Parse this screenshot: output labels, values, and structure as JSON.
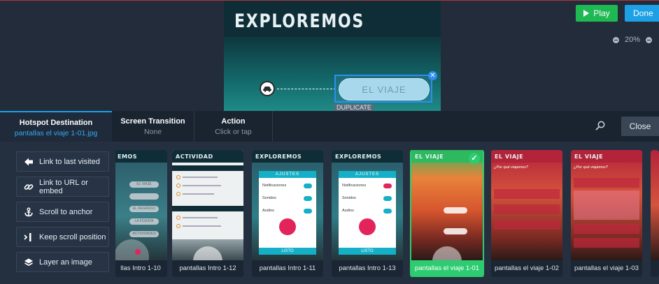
{
  "canvas": {
    "phone_title": "EXPLOREMOS",
    "hotspot_label": "EL VIAJE",
    "duplicate_label": "DUPLICATE",
    "play_label": "Play",
    "done_label": "Done",
    "zoom_level": "20%"
  },
  "tabs": [
    {
      "title": "Hotspot Destination",
      "value": "pantallas el viaje 1-01.jpg"
    },
    {
      "title": "Screen Transition",
      "value": "None"
    },
    {
      "title": "Action",
      "value": "Click or tap"
    }
  ],
  "close_label": "Close",
  "sidebar": {
    "items": [
      {
        "label": "Link to last visited",
        "icon": "arrow-left-icon"
      },
      {
        "label": "Link to URL or embed",
        "icon": "link-icon"
      },
      {
        "label": "Scroll to anchor",
        "icon": "anchor-icon"
      },
      {
        "label": "Keep scroll position",
        "icon": "keep-scroll-icon"
      },
      {
        "label": "Layer an image",
        "icon": "layers-icon"
      }
    ]
  },
  "screens": [
    {
      "caption": "llas Intro 1-10",
      "header": "EMOS",
      "selected": false
    },
    {
      "caption": "pantallas Intro 1-12",
      "header": "ACTIVIDAD",
      "selected": false
    },
    {
      "caption": "pantallas Intro 1-11",
      "header": "EXPLOREMOS",
      "selected": false
    },
    {
      "caption": "pantallas Intro 1-13",
      "header": "EXPLOREMOS",
      "selected": false
    },
    {
      "caption": "pantallas el viaje 1-01",
      "header": "EL VIAJE",
      "selected": true
    },
    {
      "caption": "pantallas el viaje 1-02",
      "header": "EL VIAJE",
      "selected": false
    },
    {
      "caption": "pantallas el viaje 1-03",
      "header": "EL VIAJE",
      "selected": false
    }
  ],
  "settings_card": {
    "title": "AJUSTES",
    "rows": [
      "Notificaciones",
      "Sonidos",
      "Audios"
    ],
    "button": "LISTO"
  },
  "intro10_pills": [
    "EL VIAJE",
    "EL REGRESO",
    "LA FOGATA",
    "ACTIVIDADES"
  ],
  "viaje_question": "¿Por qué viajamos?",
  "colors": {
    "accent": "#1da0e6",
    "play": "#1fb954",
    "selected": "#2ecc71",
    "brand_red": "#b3233a"
  }
}
